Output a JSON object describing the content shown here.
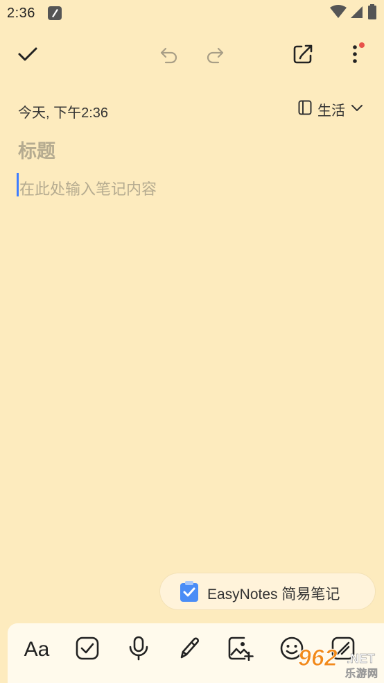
{
  "status_bar": {
    "time": "2:36",
    "icons": [
      "app-notification-icon",
      "wifi-icon",
      "cellular-signal-icon",
      "battery-icon"
    ]
  },
  "toolbar": {
    "buttons": [
      "check-icon",
      "undo-icon",
      "redo-icon",
      "share-icon",
      "more-vert-icon"
    ],
    "has_notification_dot": true
  },
  "note": {
    "date": "今天, 下午2:36",
    "category": "生活",
    "title_placeholder": "标题",
    "body_placeholder": "在此处输入笔记内容"
  },
  "badge": {
    "text": "EasyNotes 简易笔记"
  },
  "bottom_toolbar": {
    "text_format_label": "Aa",
    "buttons": [
      "text-format",
      "checklist-icon",
      "mic-icon",
      "pen-icon",
      "add-image-icon",
      "emoji-icon",
      "attachment-icon"
    ]
  },
  "watermark": {
    "number": "962",
    "domain": ".NET",
    "name": "乐游网"
  },
  "colors": {
    "background": "#FDEBBE",
    "accent": "#3E7DFF",
    "dot": "#E8524A",
    "placeholder": "#B5AB90"
  }
}
